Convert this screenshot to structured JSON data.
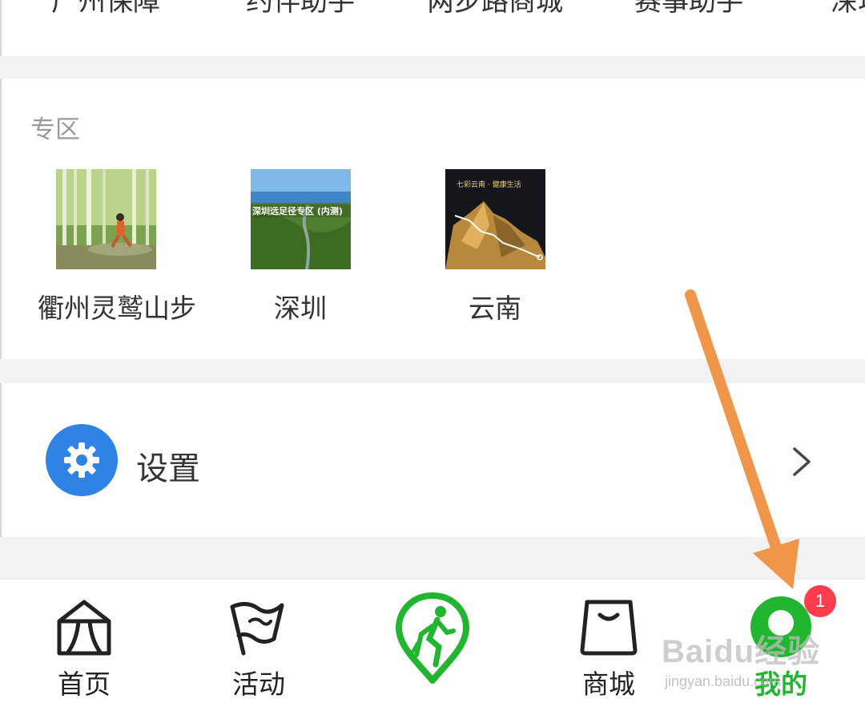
{
  "top_services": [
    "广州保障",
    "约伴助手",
    "两步路商城",
    "赛事助手",
    "深圳"
  ],
  "zone": {
    "title": "专区",
    "items": [
      {
        "label": "衢州灵鹫山步",
        "thumb_icon": "bamboo-forest-runner-photo"
      },
      {
        "label": "深圳",
        "thumb_icon": "shenzhen-trail-photo",
        "thumb_text": "深圳远足径专区 (内测)"
      },
      {
        "label": "云南",
        "thumb_icon": "yunnan-mountain-photo",
        "thumb_text": "七彩云南 · 健康生活"
      }
    ]
  },
  "settings": {
    "label": "设置",
    "icon": "gear-icon",
    "icon_bg": "#2f83e5"
  },
  "tabbar": {
    "tabs": [
      {
        "label": "首页",
        "icon": "home-tent-icon"
      },
      {
        "label": "活动",
        "icon": "flag-icon"
      },
      {
        "label": "",
        "icon": "hiker-pin-logo-icon"
      },
      {
        "label": "商城",
        "icon": "shopping-bag-icon"
      },
      {
        "label": "我的",
        "icon": "user-avatar-icon"
      }
    ],
    "active_color": "#22b530",
    "badge_count": "1"
  },
  "watermark": {
    "main": "Baidu经验",
    "sub": "jingyan.baidu.com"
  },
  "annotation_color": "#f0964a"
}
